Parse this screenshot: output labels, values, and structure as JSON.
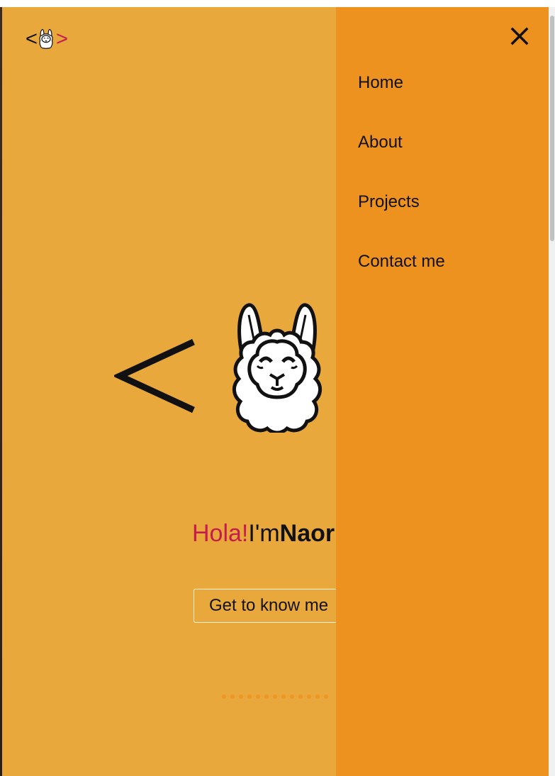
{
  "header": {
    "logo_left": "<",
    "logo_right": ">",
    "logo_icon": "llama-icon"
  },
  "hero": {
    "big_symbol": "<",
    "big_icon": "llama-face-icon",
    "greeting_hola": "Hola!",
    "greeting_im": "I'm",
    "greeting_name": "Naor",
    "cta_label": "Get to know me"
  },
  "carousel": {
    "dot_count": 13
  },
  "drawer": {
    "close_icon": "close-icon",
    "items": [
      {
        "label": "Home"
      },
      {
        "label": "About"
      },
      {
        "label": "Projects"
      },
      {
        "label": "Contact me"
      }
    ]
  },
  "colors": {
    "background": "#e9a83c",
    "drawer": "#ed911f",
    "accent": "#c41d4d",
    "text": "#111111",
    "dots": "#f09524"
  }
}
